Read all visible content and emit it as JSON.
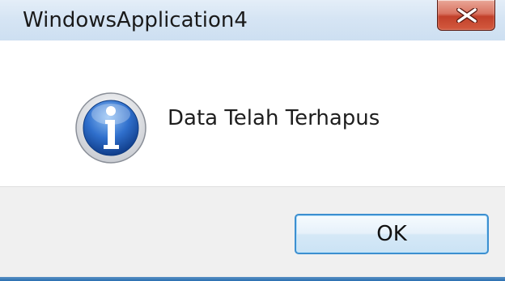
{
  "window": {
    "title": "WindowsApplication4"
  },
  "dialog": {
    "message": "Data Telah Terhapus",
    "icon": "information-icon"
  },
  "buttons": {
    "ok_label": "OK",
    "close_icon": "close-icon"
  },
  "colors": {
    "titlebar": "#d6e5f4",
    "close_button": "#c7452f",
    "footer": "#f0f0f0",
    "button_focus_border": "#3c8fd0",
    "info_icon_blue": "#1f5fb8"
  }
}
